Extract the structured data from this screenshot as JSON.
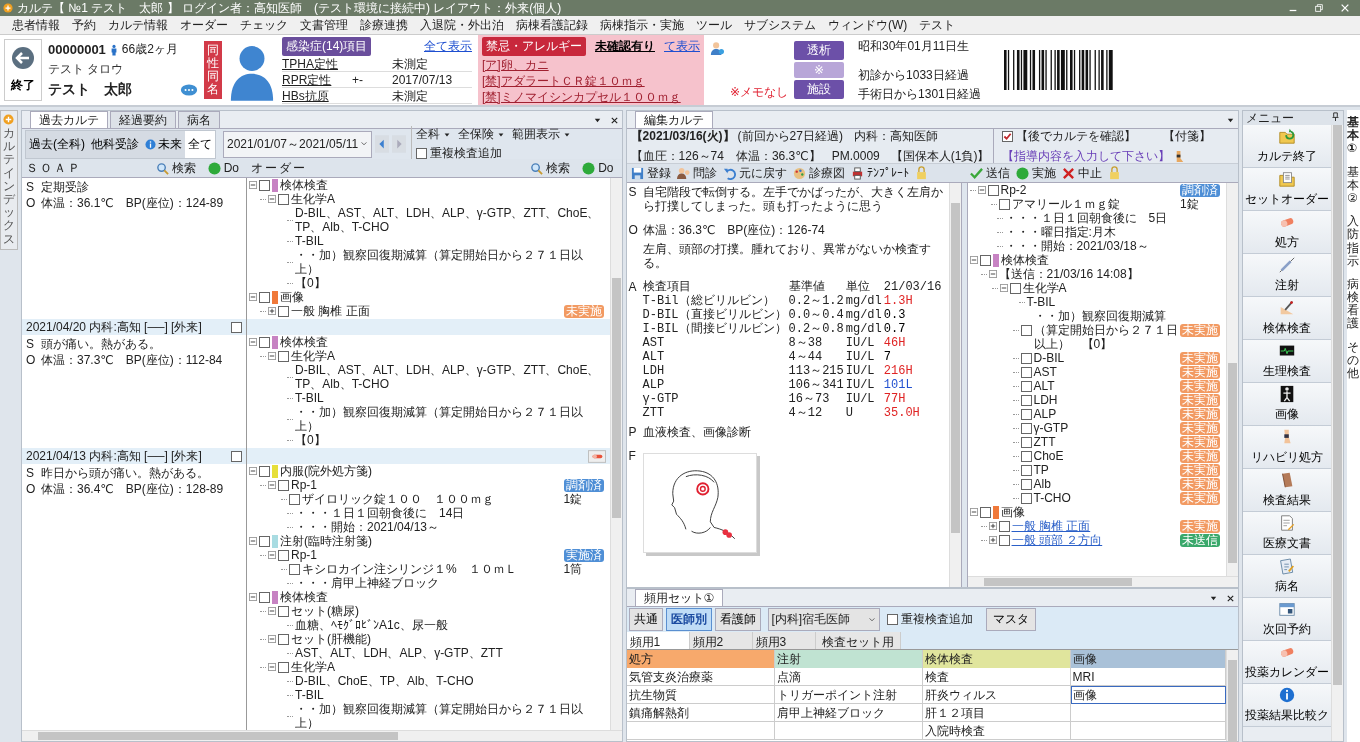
{
  "window": {
    "title": "カルテ【 №1 テスト　太郎 】 ログイン者：高知医師　(テスト環境に接続中)  レイアウト：外来(個人)"
  },
  "menu": [
    "患者情報",
    "予約",
    "カルテ情報",
    "オーダー",
    "チェック",
    "文書管理",
    "診療連携",
    "入退院・外出泊",
    "病棟看護記録",
    "病棟指示・実施",
    "ツール",
    "サブシステム",
    "ウィンドウ(W)",
    "テスト"
  ],
  "patient": {
    "exit_button": "終了",
    "id": "00000001",
    "age": "66歳2ヶ月",
    "kana": "テスト タロウ",
    "name": "テスト　太郎",
    "same_name_badge": "同性同名",
    "infection": {
      "title": "感染症(14)項目",
      "show_all": "全て表示",
      "rows": [
        {
          "name": "TPHA定性",
          "value": "未測定"
        },
        {
          "name": "RPR定性",
          "result": "+-",
          "value": "2017/07/13"
        },
        {
          "name": "HBs抗原",
          "value": "未測定"
        }
      ]
    },
    "allergy": {
      "title": "禁忌・アレルギー",
      "status": "未確認有り",
      "show": "て表示",
      "items": [
        "[ア]卵、カニ",
        "[禁]アダラートＣＲ錠１０ｍｇ",
        "[禁]ミノマイシンカプセル１００ｍｇ"
      ]
    },
    "memo": "※メモなし",
    "tags": [
      {
        "label": "透析",
        "disabled": false
      },
      {
        "label": "※",
        "disabled": true
      },
      {
        "label": "施設",
        "disabled": false
      }
    ],
    "birth": "昭和30年01月11日生",
    "since_first": "初診から1033日経過",
    "since_surgery": "手術日から1301日経過"
  },
  "past_chart": {
    "side_tab": "カルテインデックス",
    "tabs": [
      {
        "label": "過去カルテ",
        "selected": true
      },
      {
        "label": "経過要約",
        "selected": false
      },
      {
        "label": "病名",
        "selected": false
      }
    ],
    "filters": [
      {
        "label": "過去(全科)",
        "selected": false
      },
      {
        "label": "他科受診",
        "selected": false
      },
      {
        "label": "未来",
        "selected": false,
        "kind": "info"
      },
      {
        "label": "全て",
        "selected": true
      }
    ],
    "date_range": "2021/01/07～2021/05/11",
    "dropdowns": [
      "全科",
      "全保険",
      "範囲表示"
    ],
    "duplicate_check": {
      "label": "重複検査追加",
      "checked": false
    },
    "columns": [
      {
        "label": "ＳＯＡＰ",
        "search": "検索",
        "do": "Do"
      },
      {
        "label": "オーダー",
        "search": "検索",
        "do": "Do"
      }
    ],
    "encounters": [
      {
        "soap": [
          {
            "letter": "S",
            "text": "定期受診"
          },
          {
            "letter": "O",
            "text": "体温：36.1℃　BP(座位)：124-89"
          }
        ],
        "orders": [
          {
            "kind": "category",
            "label": "検体検査",
            "color": "#c783c3",
            "checked": false,
            "expanded": true,
            "children": [
              {
                "kind": "group",
                "label": "生化学A",
                "checked": false,
                "expanded": true,
                "children": [
                  {
                    "kind": "text",
                    "label": "D-BIL、AST、ALT、LDH、ALP、γ-GTP、ZTT、ChoE、TP、Alb、T-CHO"
                  },
                  {
                    "kind": "text",
                    "label": "T-BIL"
                  },
                  {
                    "kind": "text",
                    "label": "・・加）観察回復期減算（算定開始日から２７１日以上）"
                  },
                  {
                    "kind": "text",
                    "label": "【0】"
                  }
                ]
              }
            ]
          },
          {
            "kind": "category",
            "label": "画像",
            "color": "#f0793a",
            "checked": false,
            "expanded": true,
            "children": [
              {
                "kind": "group",
                "label": "一般 胸椎 正面",
                "checked": false,
                "expanded": false,
                "badge": {
                  "label": "未実施",
                  "color": "#f29a62"
                }
              }
            ]
          }
        ]
      },
      {
        "header": "2021/04/20  内科:高知 [──] [外来]",
        "checked": false,
        "soap": [
          {
            "letter": "S",
            "text": "頭が痛い。熱がある。"
          },
          {
            "letter": "O",
            "text": "体温：37.3℃　BP(座位)：112-84"
          }
        ],
        "orders": [
          {
            "kind": "category",
            "label": "検体検査",
            "color": "#c783c3",
            "checked": false,
            "expanded": true,
            "children": [
              {
                "kind": "group",
                "label": "生化学A",
                "checked": false,
                "expanded": true,
                "children": [
                  {
                    "kind": "text",
                    "label": "D-BIL、AST、ALT、LDH、ALP、γ-GTP、ZTT、ChoE、TP、Alb、T-CHO"
                  },
                  {
                    "kind": "text",
                    "label": "T-BIL"
                  },
                  {
                    "kind": "text",
                    "label": "・・加）観察回復期減算（算定開始日から２７１日以上）"
                  },
                  {
                    "kind": "text",
                    "label": "【0】"
                  }
                ]
              }
            ]
          }
        ]
      },
      {
        "header": "2021/04/13  内科:高知 [──] [外来]",
        "checked": false,
        "tool": true,
        "soap": [
          {
            "letter": "S",
            "text": "昨日から頭が痛い。熱がある。"
          },
          {
            "letter": "O",
            "text": "体温：36.4℃　BP(座位)：128-89"
          }
        ],
        "orders": [
          {
            "kind": "category",
            "label": "内服(院外処方箋)",
            "color": "#e6df3a",
            "checked": false,
            "expanded": true,
            "children": [
              {
                "kind": "group",
                "label": "Rp-1",
                "checked": false,
                "expanded": true,
                "badge": {
                  "label": "調剤済",
                  "color": "#4f8fd6"
                },
                "children": [
                  {
                    "kind": "item",
                    "label": "ザイロリック錠１００　１００ｍｇ",
                    "qty": "1錠",
                    "checked": false
                  },
                  {
                    "kind": "text",
                    "label": "・・・１日１回朝食後に　14日"
                  },
                  {
                    "kind": "text",
                    "label": "・・・開始：2021/04/13～"
                  }
                ]
              }
            ]
          },
          {
            "kind": "category",
            "label": "注射(臨時注射箋)",
            "color": "#a9dce2",
            "checked": false,
            "expanded": true,
            "children": [
              {
                "kind": "group",
                "label": "Rp-1",
                "checked": false,
                "expanded": true,
                "badge": {
                  "label": "実施済",
                  "color": "#4f8fd6"
                },
                "children": [
                  {
                    "kind": "item",
                    "label": "キシロカイン注シリンジ１%　１０ｍＬ",
                    "qty": "1筒",
                    "checked": false
                  },
                  {
                    "kind": "text",
                    "label": "・・・肩甲上神経ブロック"
                  }
                ]
              }
            ]
          },
          {
            "kind": "category",
            "label": "検体検査",
            "color": "#c783c3",
            "checked": false,
            "expanded": true,
            "children": [
              {
                "kind": "group",
                "label": "セット(糖尿)",
                "checked": false,
                "expanded": true,
                "children": [
                  {
                    "kind": "text",
                    "label": "血糖、ﾍﾓｸﾞﾛﾋﾞﾝA1c、尿一般"
                  }
                ]
              },
              {
                "kind": "group",
                "label": "セット(肝機能)",
                "checked": false,
                "expanded": true,
                "children": [
                  {
                    "kind": "text",
                    "label": "AST、ALT、LDH、ALP、γ-GTP、ZTT"
                  }
                ]
              },
              {
                "kind": "group",
                "label": "生化学A",
                "checked": false,
                "expanded": true,
                "children": [
                  {
                    "kind": "text",
                    "label": "D-BIL、ChoE、TP、Alb、T-CHO"
                  },
                  {
                    "kind": "text",
                    "label": "T-BIL"
                  },
                  {
                    "kind": "text",
                    "label": "・・加）観察回復期減算（算定開始日から２７１日以上）"
                  }
                ]
              }
            ]
          }
        ]
      }
    ]
  },
  "edit_chart": {
    "tab": "編集カルテ",
    "date": "【2021/03/16(火)】",
    "elapsed": "(前回から27日経過)",
    "doctor": "内科：高知医師",
    "vitals": "【血圧：126～74　体温：36.3℃】",
    "pm": "PM.0009",
    "insurance": "【国保本人(1負)】",
    "confirm": {
      "label": "【後でカルテを確認】",
      "checked": true
    },
    "sticky": "【付箋】",
    "guidance": "【指導内容を入力して下さい】",
    "tools_left": [
      "登録",
      "問診",
      "元に戻す",
      "診療図",
      "ﾃﾝﾌﾟﾚｰﾄ"
    ],
    "tools_right": [
      "送信",
      "実施",
      "中止"
    ],
    "soap": [
      {
        "letter": "S",
        "kind": "text",
        "paragraphs": [
          "自宅階段で転倒する。左手でかばったが、大きく左肩から打撲してしまった。頭も打ったように思う"
        ]
      },
      {
        "letter": "O",
        "kind": "text",
        "paragraphs": [
          "体温：36.3℃　BP(座位)：126-74",
          "左肩、頭部の打撲。腫れており、異常がないか検査する。"
        ]
      },
      {
        "letter": "A",
        "kind": "lab",
        "columns": [
          "検査項目",
          "基準値",
          "単位",
          "21/03/16"
        ],
        "rows": [
          {
            "item": "T-Bil（総ビリルビン）",
            "range": "0.2～1.2",
            "unit": "mg/dl",
            "value": "1.3H",
            "color": "#e02424"
          },
          {
            "item": "D-BIL（直接ビリルビン）",
            "range": "0.0～0.4",
            "unit": "mg/dl",
            "value": "0.3",
            "color": "#000000"
          },
          {
            "item": "I-BIL（間接ビリルビン）",
            "range": "0.2～0.8",
            "unit": "mg/dl",
            "value": "0.7",
            "color": "#000000"
          },
          {
            "item": "AST",
            "range": "8～38",
            "unit": "IU/L",
            "value": "46H",
            "color": "#e02424"
          },
          {
            "item": "ALT",
            "range": "4～44",
            "unit": "IU/L",
            "value": "7",
            "color": "#000000"
          },
          {
            "item": "LDH",
            "range": "113～215",
            "unit": "IU/L",
            "value": "216H",
            "color": "#e02424"
          },
          {
            "item": "ALP",
            "range": "106～341",
            "unit": "IU/L",
            "value": "101L",
            "color": "#2452d0"
          },
          {
            "item": "γ-GTP",
            "range": "16～73",
            "unit": "IU/L",
            "value": "77H",
            "color": "#e02424"
          },
          {
            "item": "ZTT",
            "range": "4～12",
            "unit": "U",
            "value": "35.0H",
            "color": "#e02424"
          }
        ]
      },
      {
        "letter": "P",
        "kind": "text",
        "paragraphs": [
          "血液検査、画像診断"
        ]
      },
      {
        "letter": "F",
        "kind": "drawing"
      }
    ],
    "orders": [
      {
        "kind": "group",
        "label": "Rp-2",
        "checked": false,
        "expanded": true,
        "badge": {
          "label": "調剤済",
          "color": "#4f8fd6"
        },
        "children": [
          {
            "kind": "item",
            "label": "アマリール１ｍｇ錠",
            "qty": "1錠",
            "checked": false
          },
          {
            "kind": "text",
            "label": "・・・１日１回朝食後に　5日"
          },
          {
            "kind": "text",
            "label": "・・・曜日指定:月木"
          },
          {
            "kind": "text",
            "label": "・・・開始：2021/03/18～"
          }
        ]
      },
      {
        "kind": "category",
        "label": "検体検査",
        "color": "#c783c3",
        "checked": false,
        "expanded": true,
        "children": [
          {
            "kind": "header",
            "label": "【送信：21/03/16 14:08】",
            "expanded": true,
            "children": [
              {
                "kind": "group",
                "label": "生化学A",
                "checked": false,
                "expanded": true,
                "children": [
                  {
                    "kind": "text",
                    "label": "T-BIL"
                  },
                  {
                    "kind": "item",
                    "label": "・・加）観察回復期減算（算定開始日から２７１日以上）　【0】",
                    "checked": false,
                    "badge": {
                      "label": "未実施",
                      "color": "#f29a62"
                    }
                  },
                  {
                    "kind": "item",
                    "label": "D-BIL",
                    "checked": false,
                    "badge": {
                      "label": "未実施",
                      "color": "#f29a62"
                    }
                  },
                  {
                    "kind": "item",
                    "label": "AST",
                    "checked": false,
                    "badge": {
                      "label": "未実施",
                      "color": "#f29a62"
                    }
                  },
                  {
                    "kind": "item",
                    "label": "ALT",
                    "checked": false,
                    "badge": {
                      "label": "未実施",
                      "color": "#f29a62"
                    }
                  },
                  {
                    "kind": "item",
                    "label": "LDH",
                    "checked": false,
                    "badge": {
                      "label": "未実施",
                      "color": "#f29a62"
                    }
                  },
                  {
                    "kind": "item",
                    "label": "ALP",
                    "checked": false,
                    "badge": {
                      "label": "未実施",
                      "color": "#f29a62"
                    }
                  },
                  {
                    "kind": "item",
                    "label": "γ-GTP",
                    "checked": false,
                    "badge": {
                      "label": "未実施",
                      "color": "#f29a62"
                    }
                  },
                  {
                    "kind": "item",
                    "label": "ZTT",
                    "checked": false,
                    "badge": {
                      "label": "未実施",
                      "color": "#f29a62"
                    }
                  },
                  {
                    "kind": "item",
                    "label": "ChoE",
                    "checked": false,
                    "badge": {
                      "label": "未実施",
                      "color": "#f29a62"
                    }
                  },
                  {
                    "kind": "item",
                    "label": "TP",
                    "checked": false,
                    "badge": {
                      "label": "未実施",
                      "color": "#f29a62"
                    }
                  },
                  {
                    "kind": "item",
                    "label": "Alb",
                    "checked": false,
                    "badge": {
                      "label": "未実施",
                      "color": "#f29a62"
                    }
                  },
                  {
                    "kind": "item",
                    "label": "T-CHO",
                    "checked": false,
                    "badge": {
                      "label": "未実施",
                      "color": "#f29a62"
                    }
                  }
                ]
              }
            ]
          }
        ]
      },
      {
        "kind": "category",
        "label": "画像",
        "color": "#f0793a",
        "checked": false,
        "expanded": true,
        "children": [
          {
            "kind": "group",
            "label": "一般 胸椎 正面",
            "link": true,
            "checked": false,
            "expanded": false,
            "badge": {
              "label": "未実施",
              "color": "#f29a62"
            }
          },
          {
            "kind": "group",
            "label": "一般 頭部 ２方向",
            "link": true,
            "checked": false,
            "expanded": false,
            "badge": {
              "label": "未送信",
              "color": "#3aa86b"
            }
          }
        ]
      }
    ]
  },
  "frequent_sets": {
    "tab": "頻用セット①",
    "groups": [
      {
        "label": "共通",
        "selected": false
      },
      {
        "label": "医師別",
        "selected": true
      },
      {
        "label": "看護師",
        "selected": false
      }
    ],
    "doctor": "[内科]宿毛医師",
    "duplicate_check": {
      "label": "重複検査追加",
      "checked": false
    },
    "master_button": "マスタ",
    "tabs": [
      {
        "label": "頻用1",
        "selected": true
      },
      {
        "label": "頻用2",
        "selected": false
      },
      {
        "label": "頻用3",
        "selected": false
      },
      {
        "label": "検査セット用",
        "selected": false
      }
    ],
    "columns": [
      {
        "label": "処方",
        "color": "#f7a96c"
      },
      {
        "label": "注射",
        "color": "#c0e3d2"
      },
      {
        "label": "検体検査",
        "color": "#e0e59d"
      },
      {
        "label": "画像",
        "color": "#a9c1d8"
      }
    ],
    "rows": [
      [
        {
          "text": "気管支炎治療薬",
          "selected": false
        },
        {
          "text": "点滴",
          "selected": false
        },
        {
          "text": "検査",
          "selected": false
        },
        {
          "text": "MRI",
          "selected": false
        }
      ],
      [
        {
          "text": "抗生物質",
          "selected": false
        },
        {
          "text": "トリガーポイント注射",
          "selected": false
        },
        {
          "text": "肝炎ウィルス",
          "selected": false
        },
        {
          "text": "画像",
          "selected": true
        }
      ],
      [
        {
          "text": "鎮痛解熱剤",
          "selected": false
        },
        {
          "text": "肩甲上神経ブロック",
          "selected": false
        },
        {
          "text": "肝１２項目",
          "selected": false
        },
        {
          "selected": false
        }
      ],
      [
        {
          "selected": false
        },
        {
          "selected": false
        },
        {
          "text": "入院時検査",
          "selected": false
        },
        {
          "selected": false
        }
      ]
    ]
  },
  "side_menu": {
    "title": "メニュー",
    "items": [
      "カルテ終了",
      "セットオーダー",
      "処方",
      "注射",
      "検体検査",
      "生理検査",
      "画像",
      "リハビリ処方",
      "検査結果",
      "医療文書",
      "病名",
      "次回予約",
      "投薬カレンダー",
      "投薬結果比較ク"
    ]
  },
  "edge_panel": {
    "fragments": [
      "基本①",
      "基本②",
      "入防指示",
      "病検看護",
      "その他"
    ]
  }
}
